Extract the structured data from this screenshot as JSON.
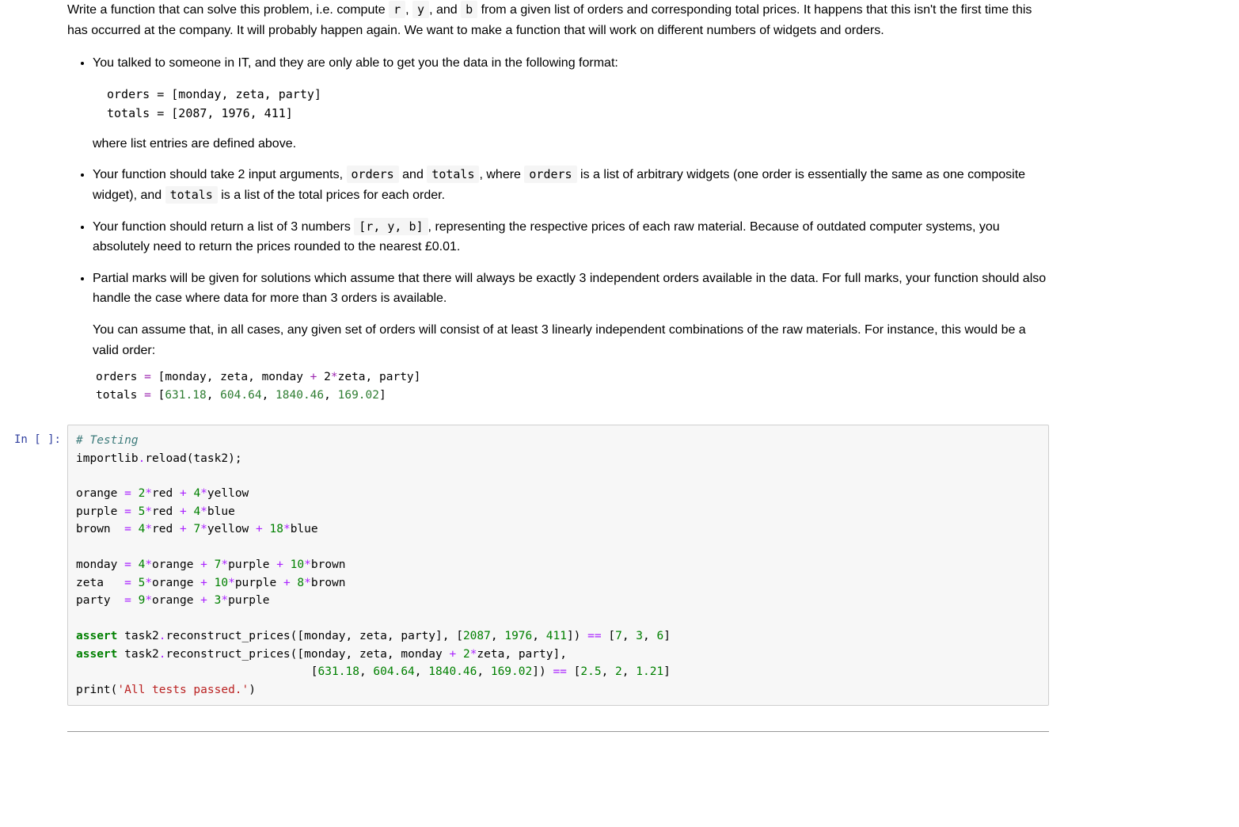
{
  "intro": {
    "prefix": "Write a function that can solve this problem, i.e. compute ",
    "r": "r",
    "sep1": ", ",
    "y": "y",
    "sep2": ", and ",
    "b": "b",
    "suffix": " from a given list of orders and corresponding total prices. It happens that this isn't the first time this has occurred at the company. It will probably happen again. We want to make a function that will work on different numbers of widgets and orders."
  },
  "bullets": {
    "b1": {
      "text": "You talked to someone in IT, and they are only able to get you the data in the following format:",
      "code": "orders = [monday, zeta, party]\ntotals = [2087, 1976, 411]",
      "after": "where list entries are defined above."
    },
    "b2": {
      "p1": "Your function should take 2 input arguments, ",
      "c_orders": "orders",
      "p2": " and ",
      "c_totals": "totals",
      "p3": ", where ",
      "c_orders2": "orders",
      "p4": " is a list of arbitrary widgets (one order is essentially the same as one composite widget), and ",
      "c_totals2": "totals",
      "p5": " is a list of the total prices for each order."
    },
    "b3": {
      "p1": "Your function should return a list of 3 numbers ",
      "c_list": "[r, y, b]",
      "p2": ", representing the respective prices of each raw material. Because of outdated computer systems, you absolutely need to return the prices rounded to the nearest £0.01."
    },
    "b4": {
      "p1": "Partial marks will be given for solutions which assume that there will always be exactly 3 independent orders available in the data. For full marks, your function should also handle the case where data for more than 3 orders is available.",
      "p2": "You can assume that, in all cases, any given set of orders will consist of at least 3 linearly independent combinations of the raw materials. For instance, this would be a valid order:"
    }
  },
  "example": {
    "orders_line": {
      "lhs": "orders ",
      "eq": "=",
      "vals": [
        "monday",
        "zeta",
        "monday ",
        "+",
        " 2",
        "*",
        "zeta",
        "party"
      ]
    },
    "totals_line": {
      "lhs": "totals ",
      "eq": "=",
      "vals": [
        "631.18",
        "604.64",
        "1840.46",
        "169.02"
      ]
    }
  },
  "cell": {
    "prompt": "In [ ]:",
    "lines": {
      "l01": "# Testing",
      "l02a": "importlib",
      "l02b": ".",
      "l02c": "reload",
      "l02d": "(",
      "l02e": "task2",
      "l02f": ");",
      "l03": "",
      "l04a": "orange ",
      "l04eq": "=",
      "l04b": " ",
      "l04n1": "2",
      "l04s1": "*",
      "l04c": "red ",
      "l04p1": "+",
      "l04d": " ",
      "l04n2": "4",
      "l04s2": "*",
      "l04e": "yellow",
      "l05a": "purple ",
      "l05eq": "=",
      "l05b": " ",
      "l05n1": "5",
      "l05s1": "*",
      "l05c": "red ",
      "l05p1": "+",
      "l05d": " ",
      "l05n2": "4",
      "l05s2": "*",
      "l05e": "blue",
      "l06a": "brown  ",
      "l06eq": "=",
      "l06b": " ",
      "l06n1": "4",
      "l06s1": "*",
      "l06c": "red ",
      "l06p1": "+",
      "l06d": " ",
      "l06n2": "7",
      "l06s2": "*",
      "l06e": "yellow ",
      "l06p2": "+",
      "l06f": " ",
      "l06n3": "18",
      "l06s3": "*",
      "l06g": "blue",
      "l07": "",
      "l08a": "monday ",
      "l08eq": "=",
      "l08b": " ",
      "l08n1": "4",
      "l08s1": "*",
      "l08c": "orange ",
      "l08p1": "+",
      "l08d": " ",
      "l08n2": "7",
      "l08s2": "*",
      "l08e": "purple ",
      "l08p2": "+",
      "l08f": " ",
      "l08n3": "10",
      "l08s3": "*",
      "l08g": "brown",
      "l09a": "zeta   ",
      "l09eq": "=",
      "l09b": " ",
      "l09n1": "5",
      "l09s1": "*",
      "l09c": "orange ",
      "l09p1": "+",
      "l09d": " ",
      "l09n2": "10",
      "l09s2": "*",
      "l09e": "purple ",
      "l09p2": "+",
      "l09f": " ",
      "l09n3": "8",
      "l09s3": "*",
      "l09g": "brown",
      "l10a": "party  ",
      "l10eq": "=",
      "l10b": " ",
      "l10n1": "9",
      "l10s1": "*",
      "l10c": "orange ",
      "l10p1": "+",
      "l10d": " ",
      "l10n2": "3",
      "l10s2": "*",
      "l10e": "purple",
      "l11": "",
      "l12kw": "assert",
      "l12a": " task2",
      "l12d1": ".",
      "l12b": "reconstruct_prices",
      "l12br1": "([",
      "l12c": "monday",
      "l12cm1": ", ",
      "l12d": "zeta",
      "l12cm2": ", ",
      "l12e": "party",
      "l12br2": "], [",
      "l12n1": "2087",
      "l12cm3": ", ",
      "l12n2": "1976",
      "l12cm4": ", ",
      "l12n3": "411",
      "l12br3": "]) ",
      "l12eq": "==",
      "l12sp": " [",
      "l12n4": "7",
      "l12cm5": ", ",
      "l12n5": "3",
      "l12cm6": ", ",
      "l12n6": "6",
      "l12br4": "]",
      "l13kw": "assert",
      "l13a": " task2",
      "l13d1": ".",
      "l13b": "reconstruct_prices",
      "l13br1": "([",
      "l13c": "monday",
      "l13cm1": ", ",
      "l13d": "zeta",
      "l13cm2": ", ",
      "l13e": "monday ",
      "l13p": "+",
      "l13sp1": " ",
      "l13n0": "2",
      "l13st": "*",
      "l13f": "zeta",
      "l13cm3": ", ",
      "l13g": "party",
      "l13br2": "],",
      "l14pad": "                                  [",
      "l14n1": "631.18",
      "l14cm1": ", ",
      "l14n2": "604.64",
      "l14cm2": ", ",
      "l14n3": "1840.46",
      "l14cm3": ", ",
      "l14n4": "169.02",
      "l14br": "]) ",
      "l14eq": "==",
      "l14sp": " [",
      "l14n5": "2.5",
      "l14cm4": ", ",
      "l14n6": "2",
      "l14cm5": ", ",
      "l14n7": "1.21",
      "l14br2": "]",
      "l15a": "print",
      "l15b": "(",
      "l15s": "'All tests passed.'",
      "l15c": ")"
    }
  }
}
